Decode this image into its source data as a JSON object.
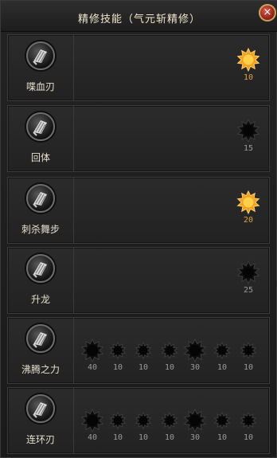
{
  "window": {
    "title": "精修技能（气元斩精修）",
    "close_label": "×"
  },
  "skills": [
    {
      "name": "喋血刃",
      "nodes": [
        {
          "value": "10",
          "active": true
        }
      ]
    },
    {
      "name": "回体",
      "nodes": [
        {
          "value": "15",
          "active": false
        }
      ]
    },
    {
      "name": "刺杀舞步",
      "nodes": [
        {
          "value": "20",
          "active": true
        }
      ]
    },
    {
      "name": "升龙",
      "nodes": [
        {
          "value": "25",
          "active": false
        }
      ]
    },
    {
      "name": "沸腾之力",
      "nodes": [
        {
          "value": "40",
          "active": false
        },
        {
          "value": "10",
          "active": false
        },
        {
          "value": "10",
          "active": false
        },
        {
          "value": "10",
          "active": false
        },
        {
          "value": "30",
          "active": false
        },
        {
          "value": "10",
          "active": false
        },
        {
          "value": "10",
          "active": false
        }
      ]
    },
    {
      "name": "连环刃",
      "nodes": [
        {
          "value": "40",
          "active": false
        },
        {
          "value": "10",
          "active": false
        },
        {
          "value": "10",
          "active": false
        },
        {
          "value": "10",
          "active": false
        },
        {
          "value": "30",
          "active": false
        },
        {
          "value": "10",
          "active": false
        },
        {
          "value": "10",
          "active": false
        }
      ]
    }
  ],
  "colors": {
    "active_node": "#f2a020",
    "inactive_node": "#0d0d0d",
    "active_value": "#e0a04a",
    "inactive_value": "#9a9a9a"
  }
}
